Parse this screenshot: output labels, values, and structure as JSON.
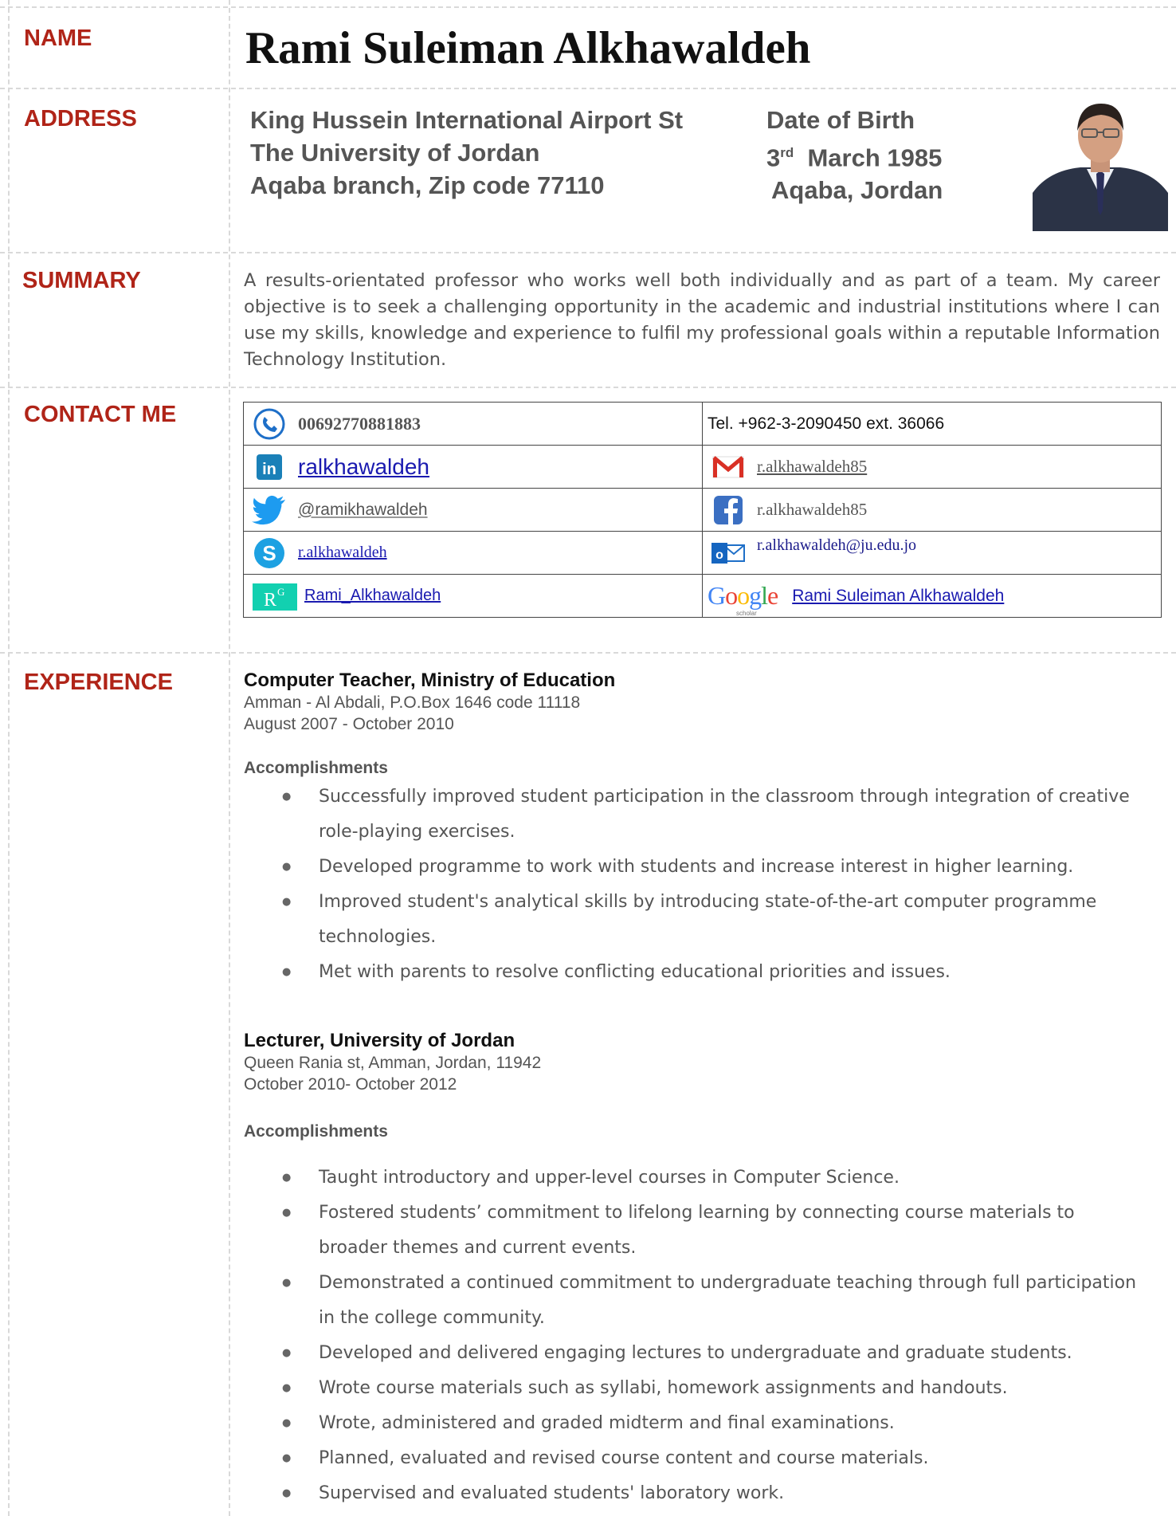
{
  "labels": {
    "name": "NAME",
    "address": "ADDRESS",
    "summary": "SUMMARY",
    "contact": "CONTACT ME",
    "experience": "EXPERIENCE"
  },
  "full_name": "Rami Suleiman Alkhawaldeh",
  "address_lines": [
    "King Hussein International Airport St",
    "The University of Jordan",
    "Aqaba branch, Zip code 77110"
  ],
  "dob": {
    "title": "Date of Birth",
    "day": "3",
    "suffix": "rd",
    "month_year": "March 1985",
    "place": "Aqaba, Jordan"
  },
  "summary_text": "A results-orientated professor who works well both individually and as part of a team. My career objective is to seek a challenging opportunity in the academic and industrial institutions where I can use my skills, knowledge and experience to fulfil my professional goals within a reputable Information Technology Institution.",
  "contact": {
    "phone": "00692770881883",
    "tel": "Tel. +962-3-2090450 ext. 36066",
    "linkedin": "ralkhawaldeh",
    "gmail": "r.alkhawaldeh85",
    "twitter": "@ramikhawaldeh",
    "facebook": "r.alkhawaldeh85",
    "skype": "r.alkhawaldeh",
    "outlook": "r.alkhawaldeh@ju.edu.jo",
    "researchgate": "Rami_Alkhawaldeh",
    "scholar": "Rami Suleiman Alkhawaldeh",
    "google_logo": "Google",
    "scholar_sub": "scholar"
  },
  "experience": [
    {
      "title": "Computer Teacher, Ministry of Education",
      "address": "Amman - Al Abdali, P.O.Box 1646  code 11118",
      "dates": "August 2007 -  October 2010",
      "acc_label": "Accomplishments",
      "items": [
        "Successfully improved student participation in the classroom through integration of creative role-playing exercises.",
        "Developed programme to work with students and increase interest in higher learning.",
        "Improved student's analytical skills by introducing state-of-the-art computer programme technologies.",
        "Met with parents to resolve conflicting educational priorities and issues."
      ]
    },
    {
      "title": "Lecturer, University of Jordan",
      "address": "Queen Rania st, Amman, Jordan, 11942",
      "dates": "October 2010- October 2012",
      "acc_label": "Accomplishments",
      "items": [
        "Taught introductory and upper-level courses in Computer Science.",
        "Fostered students’ commitment to lifelong learning by connecting course materials to broader themes and current events.",
        "Demonstrated a continued commitment to undergraduate teaching through full participation in the college community.",
        "Developed and delivered engaging lectures to undergraduate and graduate students.",
        "Wrote course materials such as syllabi, homework assignments and handouts.",
        "Wrote, administered and graded midterm and final examinations.",
        "Planned, evaluated and revised course content and course materials.",
        "Supervised and evaluated students' laboratory work."
      ]
    }
  ]
}
